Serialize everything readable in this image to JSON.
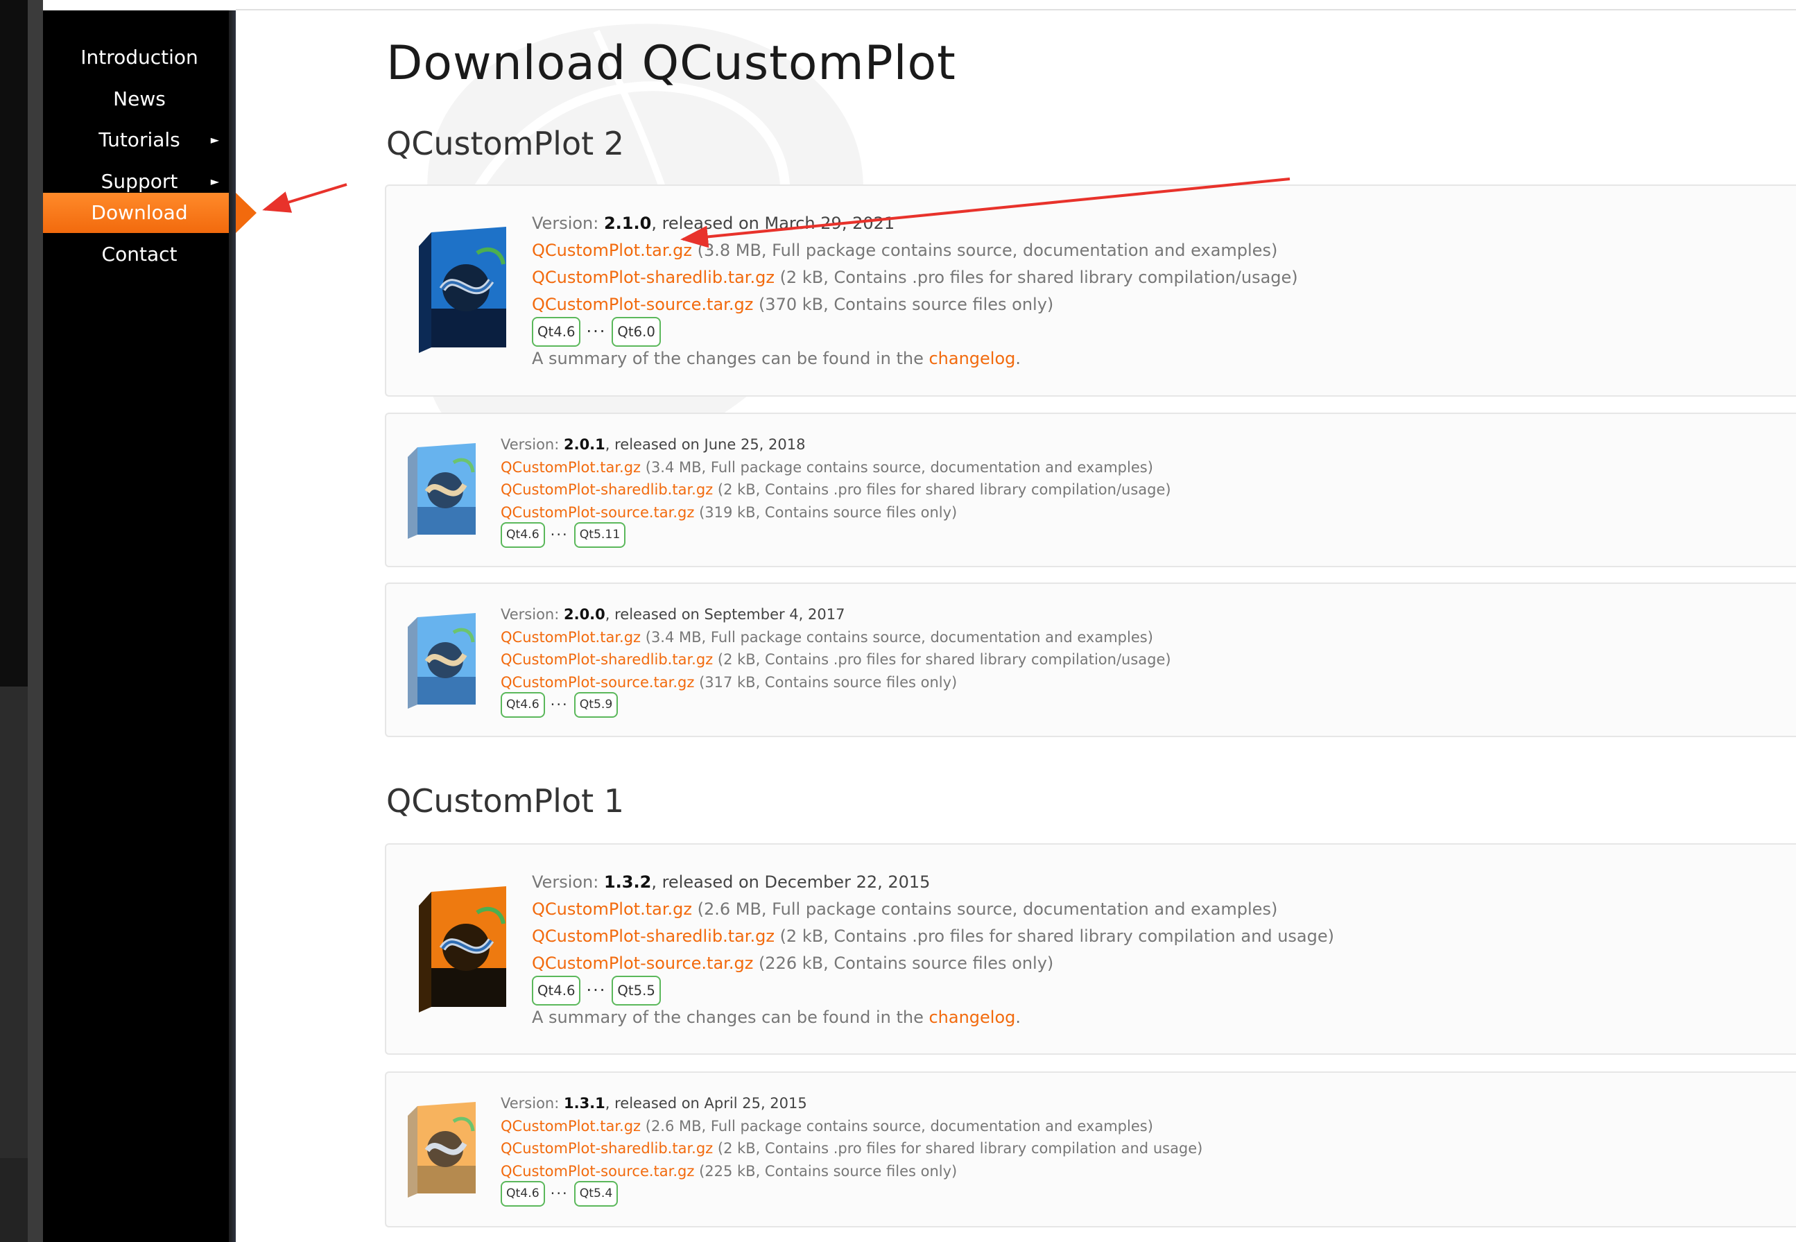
{
  "nav": {
    "items": [
      {
        "label": "Introduction",
        "arrow": ""
      },
      {
        "label": "News",
        "arrow": ""
      },
      {
        "label": "Tutorials",
        "arrow": "►"
      },
      {
        "label": "Support",
        "arrow": "►"
      },
      {
        "label": "Download",
        "arrow": ""
      },
      {
        "label": "Contact",
        "arrow": ""
      }
    ],
    "active": "Download"
  },
  "page": {
    "title": "Download QCustomPlot",
    "sections": [
      {
        "title": "QCustomPlot 2"
      },
      {
        "title": "QCustomPlot 1"
      }
    ]
  },
  "common": {
    "version_label": "Version: ",
    "released_prefix": ", released on ",
    "full_label": "QCustomPlot.tar.gz",
    "shared_label": "QCustomPlot-sharedlib.tar.gz",
    "source_label": "QCustomPlot-source.tar.gz",
    "dots": "···",
    "changelog_prefix": "A summary of the changes can be found in the ",
    "changelog_link": "changelog",
    "changelog_suffix": "."
  },
  "releases": [
    {
      "version": "2.1.0",
      "date": "March 29, 2021",
      "full_desc": " (3.8 MB, Full package contains source, documentation and examples)",
      "shared_desc": " (2 kB, Contains .pro files for shared library compilation/usage)",
      "source_desc": " (370 kB, Contains source files only)",
      "qt_min": "Qt4.6",
      "qt_max": "Qt6.0",
      "box_color": "blue"
    },
    {
      "version": "2.0.1",
      "date": "June 25, 2018",
      "full_desc": " (3.4 MB, Full package contains source, documentation and examples)",
      "shared_desc": " (2 kB, Contains .pro files for shared library compilation/usage)",
      "source_desc": " (319 kB, Contains source files only)",
      "qt_min": "Qt4.6",
      "qt_max": "Qt5.11",
      "box_color": "light-blue"
    },
    {
      "version": "2.0.0",
      "date": "September 4, 2017",
      "full_desc": " (3.4 MB, Full package contains source, documentation and examples)",
      "shared_desc": " (2 kB, Contains .pro files for shared library compilation/usage)",
      "source_desc": " (317 kB, Contains source files only)",
      "qt_min": "Qt4.6",
      "qt_max": "Qt5.9",
      "box_color": "light-blue"
    },
    {
      "version": "1.3.2",
      "date": "December 22, 2015",
      "full_desc": " (2.6 MB, Full package contains source, documentation and examples)",
      "shared_desc": " (2 kB, Contains .pro files for shared library compilation and usage)",
      "source_desc": " (226 kB, Contains source files only)",
      "qt_min": "Qt4.6",
      "qt_max": "Qt5.5",
      "box_color": "orange"
    },
    {
      "version": "1.3.1",
      "date": "April 25, 2015",
      "full_desc": " (2.6 MB, Full package contains source, documentation and examples)",
      "shared_desc": " (2 kB, Contains .pro files for shared library compilation and usage)",
      "source_desc": " (225 kB, Contains source files only)",
      "qt_min": "Qt4.6",
      "qt_max": "Qt5.4",
      "box_color": "light-orange"
    }
  ],
  "colors": {
    "accent": "#f26a0d",
    "sidebar": "#000000",
    "badge_border": "#5bb85b",
    "annotation_arrow": "#e8322b"
  }
}
